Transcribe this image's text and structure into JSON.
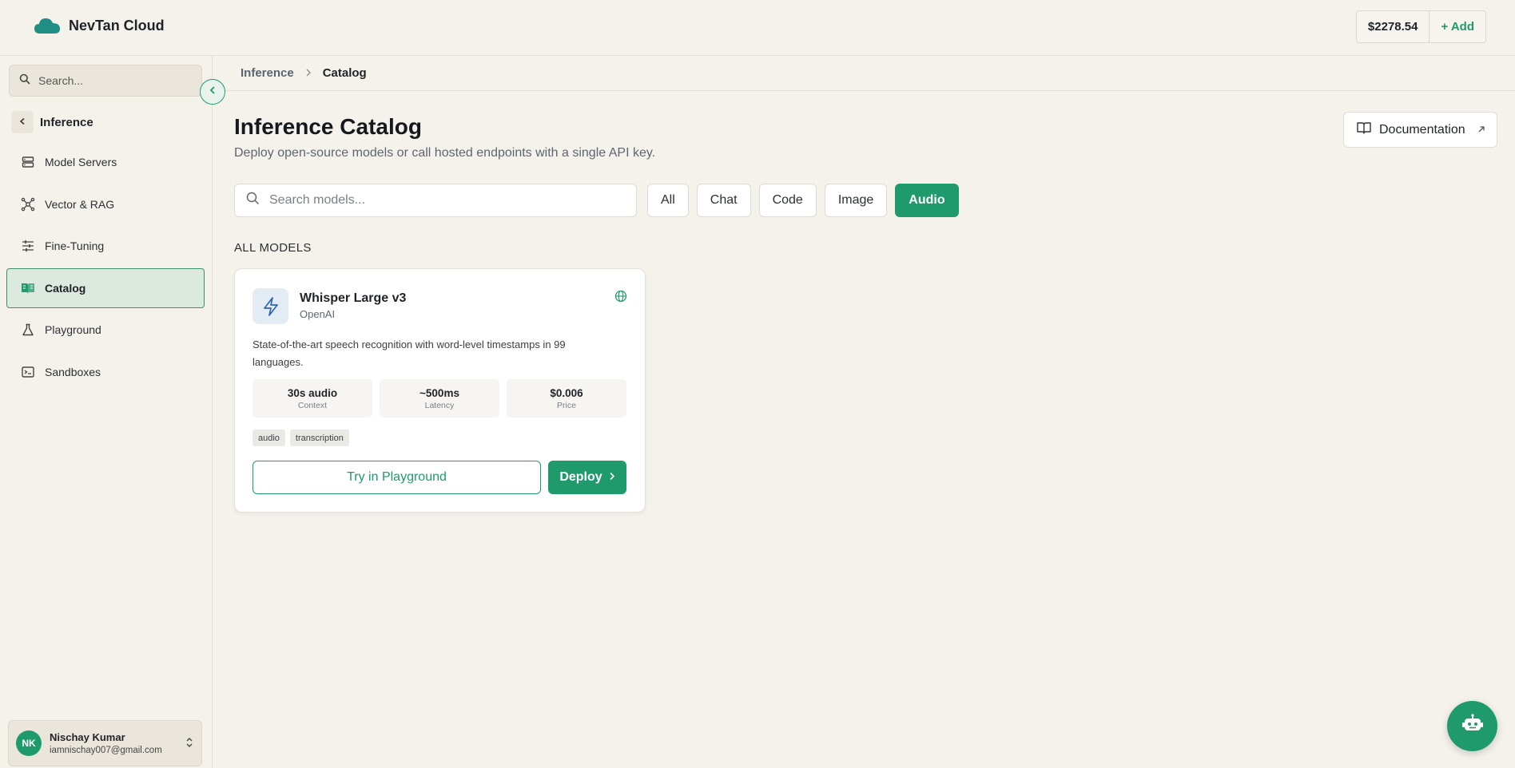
{
  "brand": {
    "name": "NevTan Cloud",
    "accent": "#1f9a6c"
  },
  "header": {
    "balance": "$2278.54",
    "add_label": "+ Add"
  },
  "sidebar": {
    "search_placeholder": "Search...",
    "section_title": "Inference",
    "items": [
      {
        "label": "Model Servers",
        "icon": "server-icon",
        "active": false
      },
      {
        "label": "Vector & RAG",
        "icon": "network-icon",
        "active": false
      },
      {
        "label": "Fine-Tuning",
        "icon": "sliders-icon",
        "active": false
      },
      {
        "label": "Catalog",
        "icon": "book-icon",
        "active": true
      },
      {
        "label": "Playground",
        "icon": "flask-icon",
        "active": false
      },
      {
        "label": "Sandboxes",
        "icon": "terminal-icon",
        "active": false
      }
    ],
    "user": {
      "initials": "NK",
      "name": "Nischay Kumar",
      "email": "iamnischay007@gmail.com"
    }
  },
  "breadcrumb": {
    "parent": "Inference",
    "current": "Catalog"
  },
  "main": {
    "title": "Inference Catalog",
    "subtitle": "Deploy open-source models or call hosted endpoints with a single API key.",
    "documentation_label": "Documentation",
    "search_placeholder": "Search models...",
    "filters": [
      {
        "label": "All",
        "active": false
      },
      {
        "label": "Chat",
        "active": false
      },
      {
        "label": "Code",
        "active": false
      },
      {
        "label": "Image",
        "active": false
      },
      {
        "label": "Audio",
        "active": true
      }
    ],
    "section_label": "ALL MODELS",
    "models": [
      {
        "name": "Whisper Large v3",
        "vendor": "OpenAI",
        "icon": "lightning-icon",
        "description": "State-of-the-art speech recognition with word-level timestamps in 99 languages.",
        "stats": [
          {
            "value": "30s audio",
            "key": "Context"
          },
          {
            "value": "~500ms",
            "key": "Latency"
          },
          {
            "value": "$0.006",
            "key": "Price"
          }
        ],
        "tags": [
          "audio",
          "transcription"
        ],
        "try_label": "Try in Playground",
        "deploy_label": "Deploy"
      }
    ]
  }
}
